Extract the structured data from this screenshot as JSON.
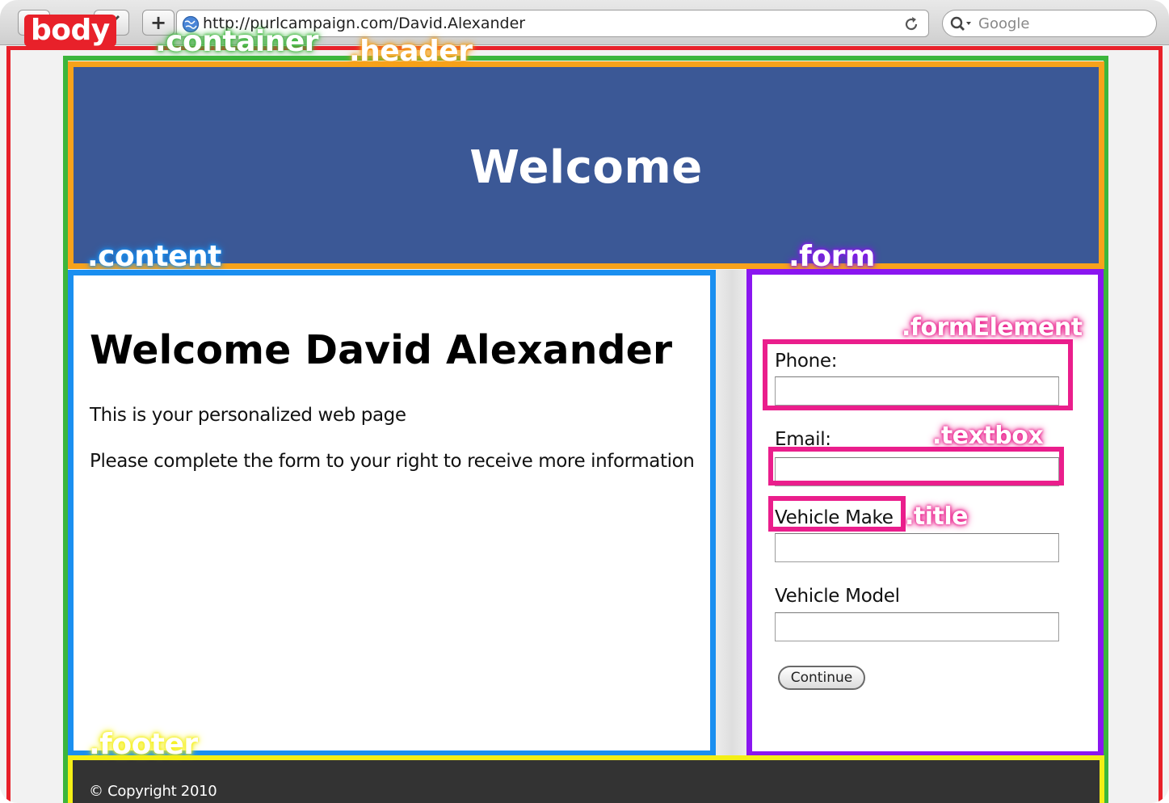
{
  "browser": {
    "url": "http://purlcampaign.com/David.Alexander",
    "search_placeholder": "Google",
    "add_button": "+"
  },
  "annotations": {
    "body": "body",
    "container": ".container",
    "header": ".header",
    "content": ".content",
    "form": ".form",
    "formElement": ".formElement",
    "textbox": ".textbox",
    "title": ".title",
    "footer": ".footer"
  },
  "header": {
    "title": "Welcome"
  },
  "content": {
    "title": "Welcome David Alexander",
    "line1": "This is your personalized web page",
    "line2": "Please complete the form to your right to receive more information"
  },
  "form": {
    "phone_label": "Phone:",
    "email_label": "Email:",
    "make_label": "Vehicle Make",
    "model_label": "Vehicle Model",
    "continue_label": "Continue"
  },
  "footer": {
    "copyright": "© Copyright 2010"
  },
  "colors": {
    "body": "#e8212a",
    "container": "#3cb63c",
    "header": "#f7a21b",
    "content": "#1a8ff0",
    "form": "#8a16f0",
    "formElement": "#ea1e8c",
    "footer": "#f4ef16",
    "header_bg": "#3b5896",
    "footer_bg": "#333333"
  }
}
